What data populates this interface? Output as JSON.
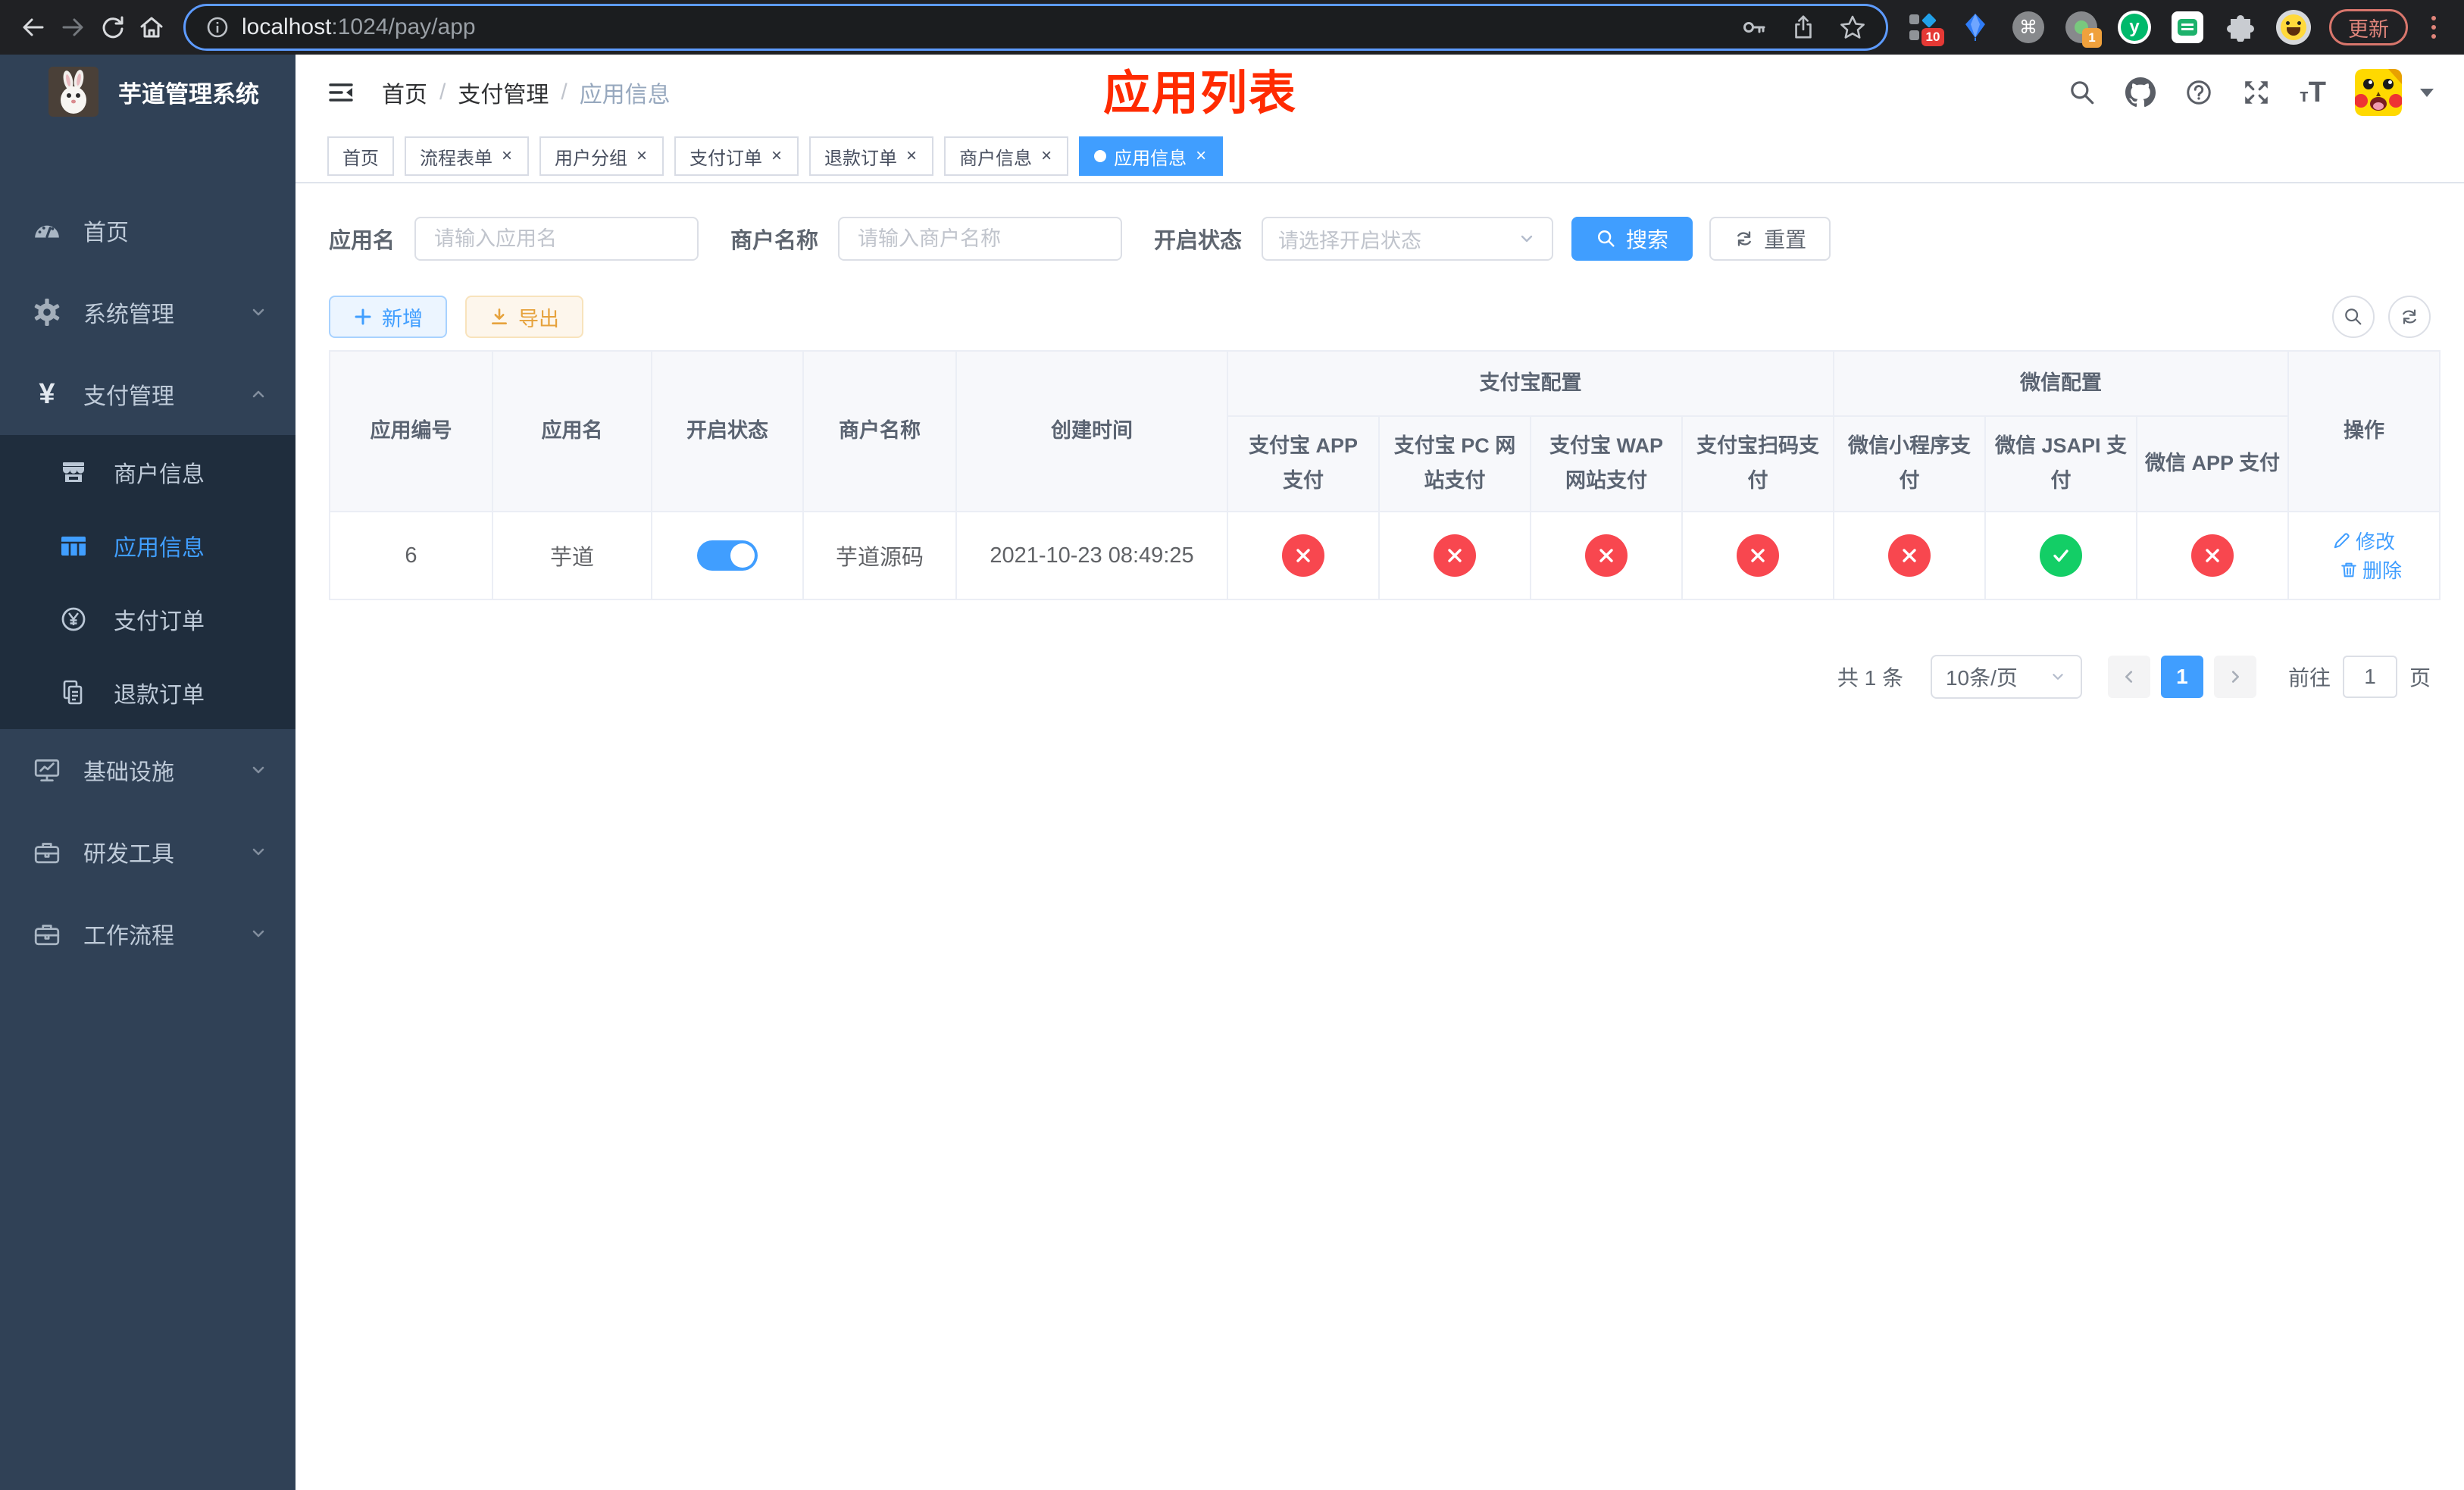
{
  "browser": {
    "url_host": "localhost",
    "url_path": ":1024/pay/app",
    "update_label": "更新",
    "ext_badge_count": "10",
    "ext_notification_count": "1",
    "yuque_letter": "y",
    "cmd_glyph": "⌘"
  },
  "sidebar": {
    "title": "芋道管理系统",
    "menu": [
      {
        "label": "首页"
      },
      {
        "label": "系统管理"
      },
      {
        "label": "支付管理"
      },
      {
        "label": "基础设施"
      },
      {
        "label": "研发工具"
      },
      {
        "label": "工作流程"
      }
    ],
    "submenu": [
      {
        "label": "商户信息"
      },
      {
        "label": "应用信息"
      },
      {
        "label": "支付订单"
      },
      {
        "label": "退款订单"
      }
    ],
    "pay_icon_glyph": "¥"
  },
  "navbar": {
    "breadcrumb": [
      "首页",
      "支付管理",
      "应用信息"
    ]
  },
  "annotation": {
    "text": "应用列表",
    "color": "#ff2b01"
  },
  "tabs": [
    {
      "label": "首页",
      "closable": false,
      "active": false
    },
    {
      "label": "流程表单",
      "closable": true,
      "active": false
    },
    {
      "label": "用户分组",
      "closable": true,
      "active": false
    },
    {
      "label": "支付订单",
      "closable": true,
      "active": false
    },
    {
      "label": "退款订单",
      "closable": true,
      "active": false
    },
    {
      "label": "商户信息",
      "closable": true,
      "active": false
    },
    {
      "label": "应用信息",
      "closable": true,
      "active": true
    }
  ],
  "search": {
    "app_name_label": "应用名",
    "app_name_placeholder": "请输入应用名",
    "merchant_label": "商户名称",
    "merchant_placeholder": "请输入商户名称",
    "status_label": "开启状态",
    "status_placeholder": "请选择开启状态",
    "search_button": "搜索",
    "reset_button": "重置"
  },
  "toolbar": {
    "add_button": "新增",
    "export_button": "导出"
  },
  "table": {
    "col_app_id": "应用编号",
    "col_app_name": "应用名",
    "col_status": "开启状态",
    "col_merchant": "商户名称",
    "col_created": "创建时间",
    "group_alipay": "支付宝配置",
    "group_wechat": "微信配置",
    "sub_cols": [
      "支付宝 APP 支付",
      "支付宝 PC 网站支付",
      "支付宝 WAP 网站支付",
      "支付宝扫码支付",
      "微信小程序支付",
      "微信 JSAPI 支付",
      "微信 APP 支付"
    ],
    "col_ops": "操作",
    "row": {
      "app_id": "6",
      "app_name": "芋道",
      "enabled": true,
      "merchant": "芋道源码",
      "created": "2021-10-23 08:49:25",
      "statuses": [
        "disabled",
        "disabled",
        "disabled",
        "disabled",
        "disabled",
        "enabled",
        "disabled"
      ],
      "edit_label": "修改",
      "delete_label": "删除"
    }
  },
  "pagination": {
    "total": "共 1 条",
    "page_size": "10条/页",
    "current_page": "1",
    "goto_label": "前往",
    "goto_value": "1",
    "page_unit": "页"
  },
  "colors": {
    "accent": "#409eff",
    "success": "#13ce66",
    "danger": "#f8474f",
    "sidebar_bg": "#304156",
    "submenu_bg": "#1f2d3d"
  }
}
